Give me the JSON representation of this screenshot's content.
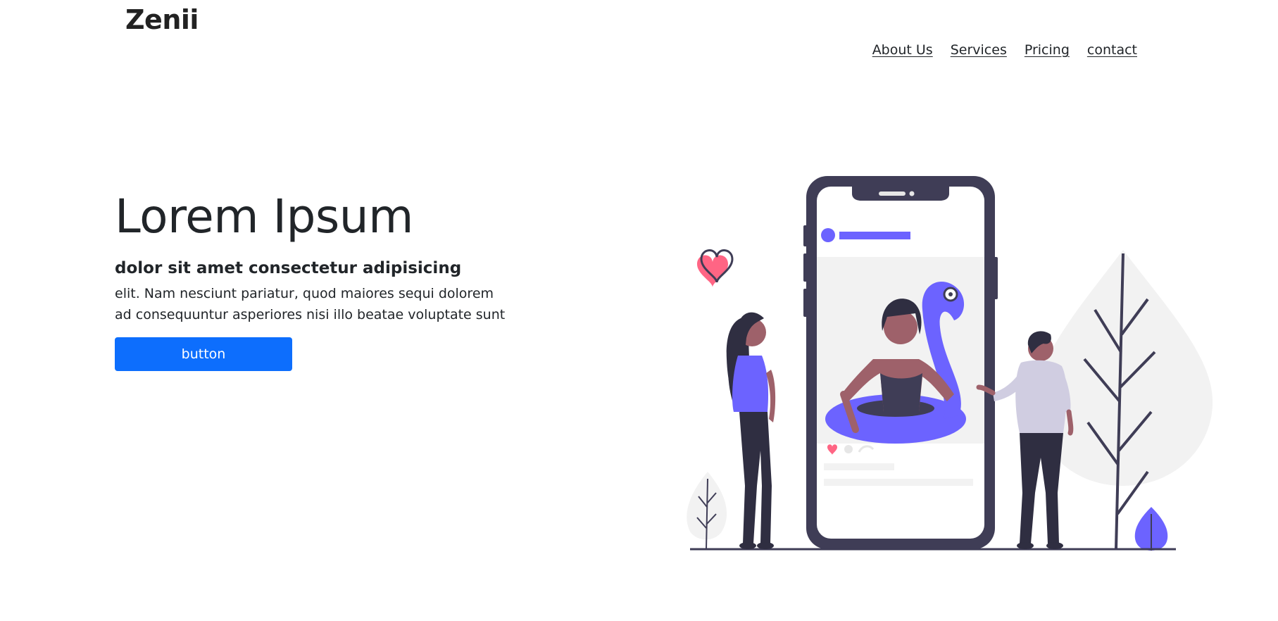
{
  "brand": {
    "name": "Zenii"
  },
  "nav": {
    "items": [
      {
        "label": "About Us"
      },
      {
        "label": "Services"
      },
      {
        "label": "Pricing"
      },
      {
        "label": "contact"
      }
    ]
  },
  "hero": {
    "title": "Lorem Ipsum",
    "subtitle": "dolor sit amet consectetur adipisicing",
    "body": "elit. Nam nesciunt pariatur, quod maiores sequi dolorem ad consequuntur asperiores nisi illo beatae voluptate sunt",
    "button_label": "button"
  },
  "colors": {
    "accent": "#0d6efd",
    "illustration_purple": "#6c63ff",
    "illustration_dark": "#3f3d56",
    "heart": "#ff6584"
  }
}
